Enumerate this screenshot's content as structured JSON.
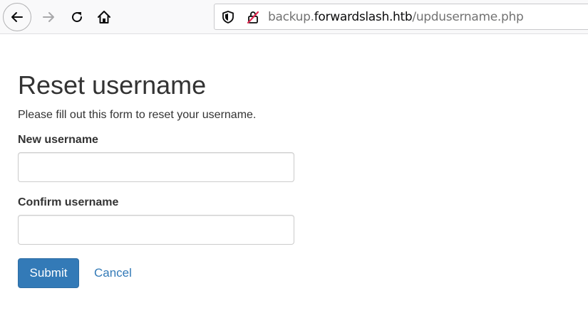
{
  "browser": {
    "url_prefix": "backup.",
    "url_host": "forwardslash.htb",
    "url_path": "/updusername.php",
    "icons": [
      "back-arrow-icon",
      "forward-arrow-icon",
      "reload-icon",
      "home-icon",
      "shield-icon",
      "insecure-lock-icon"
    ]
  },
  "page": {
    "title": "Reset username",
    "description": "Please fill out this form to reset your username.",
    "new_username_label": "New username",
    "new_username_value": "",
    "confirm_username_label": "Confirm username",
    "confirm_username_value": "",
    "submit_label": "Submit",
    "cancel_label": "Cancel"
  },
  "colors": {
    "primary": "#337ab7",
    "text": "#333333"
  }
}
